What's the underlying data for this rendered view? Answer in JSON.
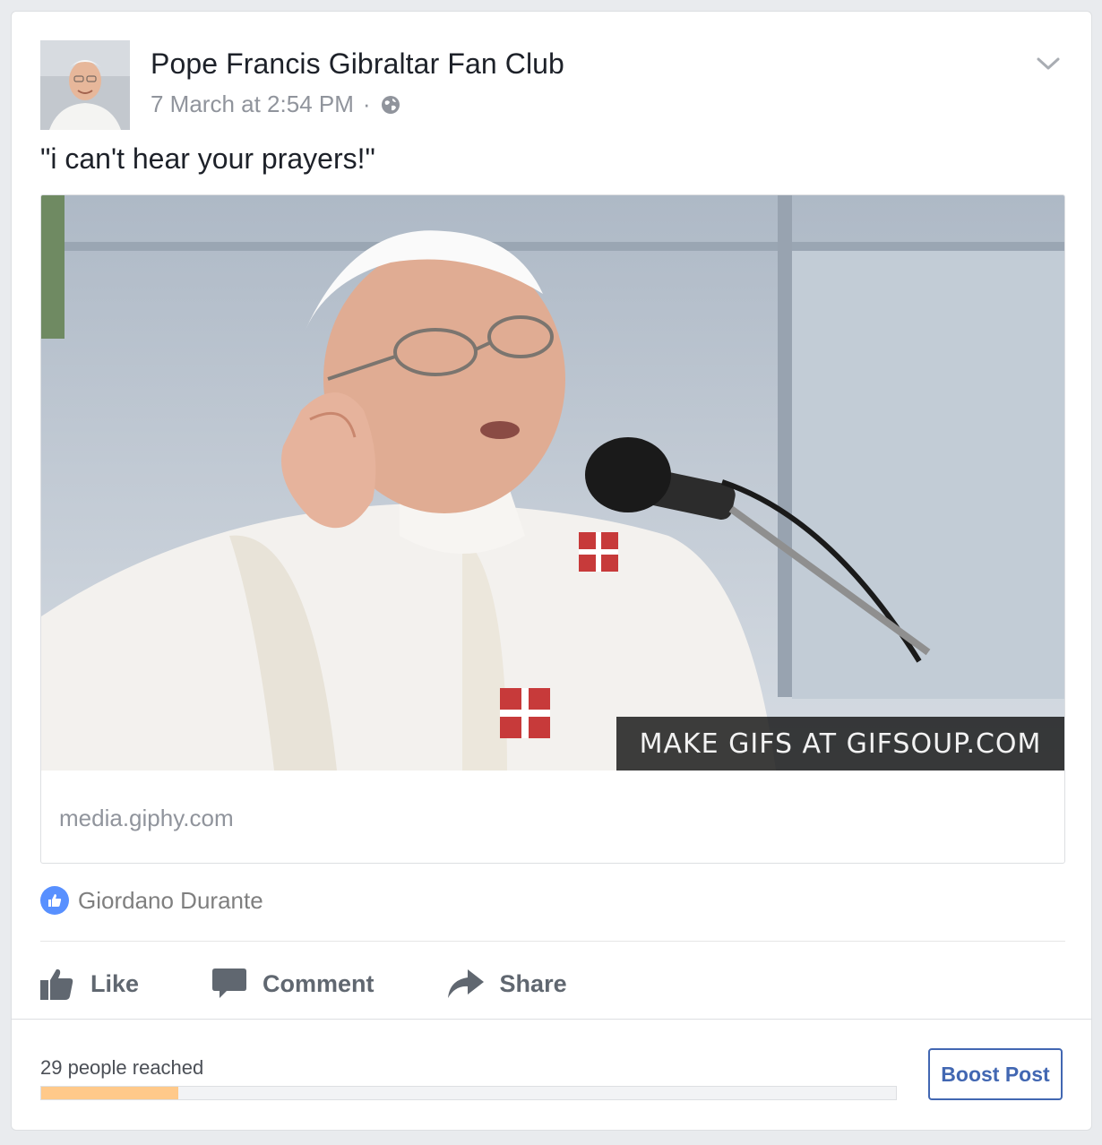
{
  "post": {
    "page_name": "Pope Francis Gibraltar Fan Club",
    "timestamp": "7 March at 2:54 PM",
    "separator": "·",
    "privacy_icon": "globe-icon",
    "text": "\"i can't hear your prayers!\"",
    "menu_icon": "chevron-down-icon"
  },
  "attachment": {
    "watermark": "MAKE GIFS AT GIFSOUP.COM",
    "domain": "media.giphy.com"
  },
  "reactions": {
    "icon": "like-badge-icon",
    "names": "Giordano Durante"
  },
  "actions": {
    "like_label": "Like",
    "comment_label": "Comment",
    "share_label": "Share"
  },
  "insights": {
    "reach_label": "29 people reached",
    "reach_progress": 0.16,
    "boost_label": "Boost Post"
  },
  "colors": {
    "accent": "#4267b2",
    "like_blue": "#5890ff",
    "reach_fill": "#ffc98a"
  }
}
